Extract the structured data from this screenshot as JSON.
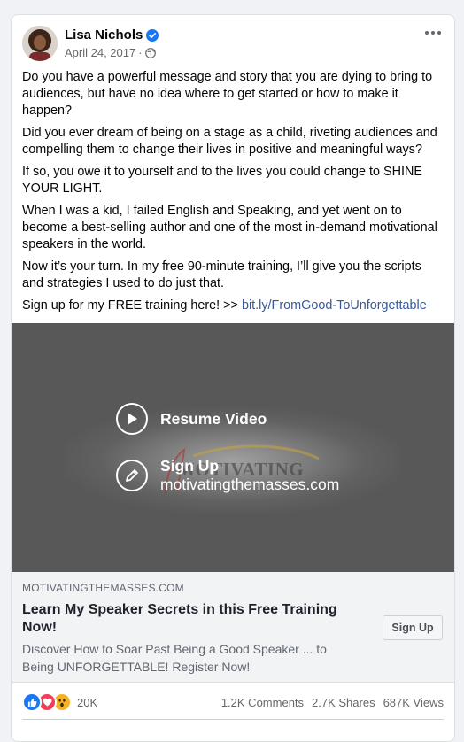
{
  "post": {
    "author": "Lisa Nichols",
    "date": "April 24, 2017",
    "separator": "·",
    "paragraphs": [
      "Do you have a powerful message and story that you are dying to bring to audiences, but have no idea where to get started or how to make it happen?",
      "Did you ever dream of being on a stage as a child, riveting audiences and compelling them to change their lives in positive and meaningful ways?",
      "If so, you owe it to yourself and to the lives you could change to SHINE YOUR LIGHT.",
      "When I was a kid, I failed English and Speaking, and yet went on to become a best-selling author and one of the most in-demand motivational speakers in the world.",
      "Now it’s your turn. In my free 90-minute training, I’ll give you the scripts and strategies I used to do just that."
    ],
    "cta_text": "Sign up for my FREE training here! >> ",
    "cta_link": "bit.ly/FromGood-ToUnforgettable"
  },
  "video": {
    "resume_label": "Resume Video",
    "signup_label": "Sign Up",
    "signup_url": "motivatingthemasses.com",
    "logo_text": "MOTIVATING"
  },
  "link_preview": {
    "domain": "MOTIVATINGTHEMASSES.COM",
    "title": "Learn My Speaker Secrets in this Free Training Now!",
    "description": "Discover How to Soar Past Being a Good Speaker ... to Being UNFORGETTABLE! Register Now!",
    "button_label": "Sign Up"
  },
  "stats": {
    "reaction_count": "20K",
    "comments": "1.2K Comments",
    "shares": "2.7K Shares",
    "views": "687K Views"
  },
  "icons": {
    "verified": "verified-badge-icon",
    "audience": "globe-icon",
    "more": "more-options-icon",
    "play": "play-icon",
    "edit": "pencil-icon",
    "reactions": [
      "like-icon",
      "love-icon",
      "wow-icon"
    ]
  },
  "colors": {
    "link": "#385898",
    "verified": "#1877f2",
    "like": "#1877f2",
    "love": "#f33e58",
    "wow": "#f7b125"
  }
}
